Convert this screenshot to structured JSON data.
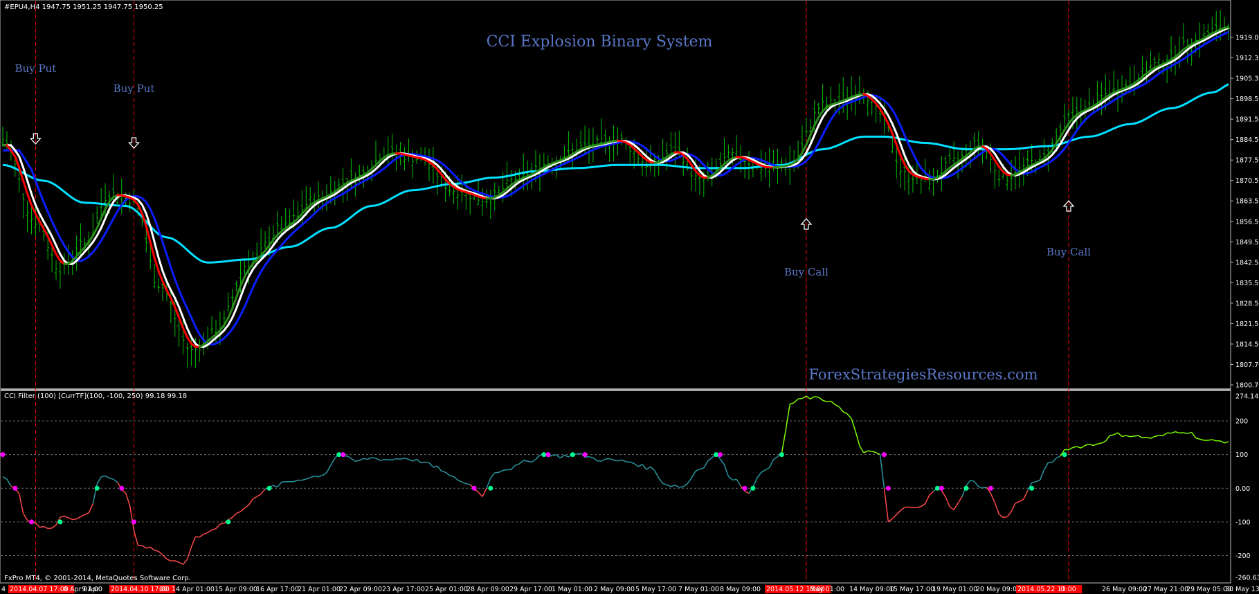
{
  "window": {
    "symbol_info": "#EPU4,H4  1947.75 1951.25 1947.75 1950.25",
    "title": "CCI Explosion Binary System",
    "watermark": "ForexStrategiesResources.com",
    "copyright": "FxPro MT4, © 2001-2014, MetaQuotes Software Corp."
  },
  "indicator": {
    "label": "CCI Filter (100) [CurrTF](100, -100, 250) 99.18 99.18",
    "ticks": [
      "274.14",
      "200",
      "100",
      "0.00",
      "-100",
      "-200",
      "-260.63"
    ],
    "levels": [
      200,
      100,
      0,
      -100,
      -200
    ]
  },
  "price_axis": {
    "ticks": [
      "1919.00",
      "1912.30",
      "1905.30",
      "1898.50",
      "1891.50",
      "1884.50",
      "1877.50",
      "1870.50",
      "1863.50",
      "1856.50",
      "1849.50",
      "1842.50",
      "1835.50",
      "1828.50",
      "1821.50",
      "1814.50",
      "1807.70",
      "1800.70"
    ]
  },
  "time_axis": {
    "labels": [
      {
        "text": "4",
        "hl": false
      },
      {
        "text": "2014.04.07 17:00",
        "hl": true
      },
      {
        "text": "8 Apr 01:00",
        "hl": false
      },
      {
        "text": "9 Apr",
        "hl": false
      },
      {
        "text": "2014.04.10 17:00",
        "hl": true
      },
      {
        "text": "00",
        "hl": false
      },
      {
        "text": "14 Apr 01:00",
        "hl": false
      },
      {
        "text": "15 Apr 09:00",
        "hl": false
      },
      {
        "text": "16 Apr 17:00",
        "hl": false
      },
      {
        "text": "21 Apr 01:00",
        "hl": false
      },
      {
        "text": "22 Apr 09:00",
        "hl": false
      },
      {
        "text": "23 Apr 17:00",
        "hl": false
      },
      {
        "text": "25 Apr 01:00",
        "hl": false
      },
      {
        "text": "28 Apr 09:00",
        "hl": false
      },
      {
        "text": "29 Apr 17:00",
        "hl": false
      },
      {
        "text": "1 May 01:00",
        "hl": false
      },
      {
        "text": "2 May 09:00",
        "hl": false
      },
      {
        "text": "5 May 17:00",
        "hl": false
      },
      {
        "text": "7 May 01:00",
        "hl": false
      },
      {
        "text": "8 May 09:00",
        "hl": false
      },
      {
        "text": "2014.05.12 13:00",
        "hl": true
      },
      {
        "text": "May 01:00",
        "hl": false
      },
      {
        "text": "14 May 09:00",
        "hl": false
      },
      {
        "text": "15 May 17:00",
        "hl": false
      },
      {
        "text": "19 May 01:00",
        "hl": false
      },
      {
        "text": "20 May 09:00",
        "hl": false
      },
      {
        "text": "2014.05.22 13:00",
        "hl": true
      },
      {
        "text": "0",
        "hl": false
      },
      {
        "text": "26 May 09:00",
        "hl": false
      },
      {
        "text": "27 May 21:00",
        "hl": false
      },
      {
        "text": "29 May 05:00",
        "hl": false
      },
      {
        "text": "30 May 13:",
        "hl": false
      }
    ]
  },
  "signals": [
    {
      "label": "Buy Put",
      "dir": "down",
      "bar": 8
    },
    {
      "label": "Buy Put",
      "dir": "down",
      "bar": 32
    },
    {
      "label": "Buy Call",
      "dir": "up",
      "bar": 196
    },
    {
      "label": "Buy Call",
      "dir": "up",
      "bar": 260
    }
  ],
  "colors": {
    "candle": "#00c000",
    "ma_blue": "#0a1eff",
    "ma_cyan": "#00e0ff",
    "ma_white": "#ffffff",
    "ma_red": "#ff0000",
    "ma_green": "#2a8c1a",
    "vline": "#ff0000",
    "cci_up": "#2a96a0",
    "cci_down": "#ff4a4a",
    "cci_strong": "#7cfc00",
    "cci_neutral": "#a0a0a0",
    "dot_buy": "#00ff90",
    "dot_sell": "#ff00ff",
    "title": "#5a78c8"
  },
  "chart_data": {
    "type": "line",
    "price_range": [
      1800.7,
      1919.0
    ],
    "cci_range": [
      -260.63,
      274.14
    ],
    "bars": 300,
    "price_keypoints": [
      [
        0,
        1879
      ],
      [
        8,
        1853
      ],
      [
        14,
        1838
      ],
      [
        20,
        1846
      ],
      [
        26,
        1862
      ],
      [
        32,
        1860
      ],
      [
        38,
        1833
      ],
      [
        46,
        1812
      ],
      [
        52,
        1818
      ],
      [
        60,
        1840
      ],
      [
        68,
        1851
      ],
      [
        76,
        1860
      ],
      [
        86,
        1867
      ],
      [
        94,
        1875
      ],
      [
        102,
        1873
      ],
      [
        110,
        1863
      ],
      [
        118,
        1860
      ],
      [
        126,
        1867
      ],
      [
        134,
        1872
      ],
      [
        142,
        1877
      ],
      [
        150,
        1879
      ],
      [
        158,
        1871
      ],
      [
        164,
        1876
      ],
      [
        170,
        1866
      ],
      [
        178,
        1874
      ],
      [
        186,
        1870
      ],
      [
        192,
        1871
      ],
      [
        200,
        1890
      ],
      [
        210,
        1894
      ],
      [
        214,
        1887
      ],
      [
        220,
        1868
      ],
      [
        226,
        1866
      ],
      [
        232,
        1872
      ],
      [
        238,
        1878
      ],
      [
        244,
        1867
      ],
      [
        252,
        1872
      ],
      [
        262,
        1888
      ],
      [
        272,
        1895
      ],
      [
        282,
        1903
      ],
      [
        290,
        1910
      ],
      [
        296,
        1914
      ],
      [
        300,
        1916
      ]
    ],
    "ma_slow_keypoints": [
      [
        0,
        1871
      ],
      [
        10,
        1866
      ],
      [
        20,
        1859
      ],
      [
        30,
        1858
      ],
      [
        40,
        1848
      ],
      [
        50,
        1840
      ],
      [
        60,
        1841
      ],
      [
        70,
        1845
      ],
      [
        80,
        1851
      ],
      [
        90,
        1858
      ],
      [
        100,
        1863
      ],
      [
        110,
        1865
      ],
      [
        120,
        1867
      ],
      [
        130,
        1869
      ],
      [
        140,
        1870
      ],
      [
        150,
        1871
      ],
      [
        160,
        1871
      ],
      [
        170,
        1870
      ],
      [
        180,
        1870
      ],
      [
        190,
        1871
      ],
      [
        200,
        1876
      ],
      [
        210,
        1880
      ],
      [
        215,
        1880
      ],
      [
        225,
        1878
      ],
      [
        235,
        1876
      ],
      [
        245,
        1876
      ],
      [
        255,
        1877
      ],
      [
        265,
        1880
      ],
      [
        275,
        1884
      ],
      [
        285,
        1889
      ],
      [
        295,
        1894
      ],
      [
        300,
        1897
      ]
    ],
    "cci_keypoints": [
      [
        0,
        30
      ],
      [
        3,
        5
      ],
      [
        6,
        -100
      ],
      [
        9,
        -110
      ],
      [
        12,
        -120
      ],
      [
        15,
        -80
      ],
      [
        18,
        -90
      ],
      [
        21,
        -70
      ],
      [
        24,
        35
      ],
      [
        27,
        30
      ],
      [
        30,
        -10
      ],
      [
        33,
        -170
      ],
      [
        37,
        -180
      ],
      [
        41,
        -215
      ],
      [
        44,
        -230
      ],
      [
        47,
        -150
      ],
      [
        50,
        -130
      ],
      [
        54,
        -100
      ],
      [
        58,
        -70
      ],
      [
        62,
        -20
      ],
      [
        66,
        5
      ],
      [
        70,
        20
      ],
      [
        74,
        30
      ],
      [
        78,
        40
      ],
      [
        82,
        100
      ],
      [
        86,
        80
      ],
      [
        90,
        90
      ],
      [
        94,
        85
      ],
      [
        98,
        90
      ],
      [
        102,
        80
      ],
      [
        106,
        60
      ],
      [
        110,
        30
      ],
      [
        114,
        10
      ],
      [
        117,
        -20
      ],
      [
        120,
        50
      ],
      [
        124,
        60
      ],
      [
        128,
        80
      ],
      [
        132,
        100
      ],
      [
        136,
        95
      ],
      [
        140,
        100
      ],
      [
        146,
        85
      ],
      [
        152,
        80
      ],
      [
        158,
        60
      ],
      [
        162,
        10
      ],
      [
        166,
        5
      ],
      [
        170,
        60
      ],
      [
        174,
        100
      ],
      [
        178,
        30
      ],
      [
        182,
        -10
      ],
      [
        186,
        60
      ],
      [
        190,
        100
      ],
      [
        192,
        250
      ],
      [
        196,
        270
      ],
      [
        202,
        260
      ],
      [
        206,
        220
      ],
      [
        210,
        110
      ],
      [
        214,
        100
      ],
      [
        216,
        -100
      ],
      [
        220,
        -60
      ],
      [
        224,
        -50
      ],
      [
        228,
        0
      ],
      [
        232,
        -60
      ],
      [
        236,
        20
      ],
      [
        240,
        0
      ],
      [
        244,
        -90
      ],
      [
        248,
        -40
      ],
      [
        252,
        20
      ],
      [
        256,
        80
      ],
      [
        260,
        120
      ],
      [
        266,
        130
      ],
      [
        272,
        160
      ],
      [
        280,
        150
      ],
      [
        288,
        170
      ],
      [
        294,
        140
      ],
      [
        300,
        140
      ]
    ]
  }
}
